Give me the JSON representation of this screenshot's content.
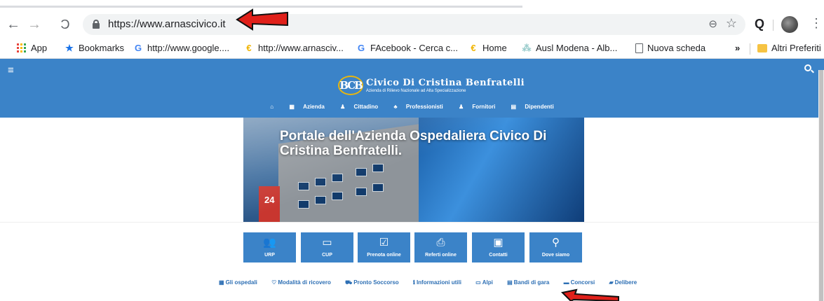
{
  "browser": {
    "url": "https://www.arnascivico.it",
    "nav_back_icon": "arrow-left-icon",
    "nav_forward_icon": "arrow-right-icon",
    "reload_icon": "reload-icon",
    "zoom_icon_glyph": "⊖",
    "star_icon_glyph": "☆",
    "ext_icon_glyph": "Q",
    "kebab_glyph": "⋮",
    "back_glyph": "←",
    "forward_glyph": "→",
    "reload_glyph": "C"
  },
  "bookmarks": {
    "items": [
      {
        "label": "App",
        "icon": "apps-grid-icon"
      },
      {
        "label": "Bookmarks",
        "icon": "star-icon",
        "glyph": "★"
      },
      {
        "label": "http://www.google....",
        "icon": "google-icon",
        "glyph": "G"
      },
      {
        "label": "http://www.arnasciv...",
        "icon": "site-favicon",
        "glyph": "€"
      },
      {
        "label": "FAcebook - Cerca c...",
        "icon": "google-icon",
        "glyph": "G"
      },
      {
        "label": "Home",
        "icon": "site-favicon",
        "glyph": "€"
      },
      {
        "label": "Ausl Modena - Alb...",
        "icon": "ausl-favicon",
        "glyph": "⁂"
      },
      {
        "label": "Nuova scheda",
        "icon": "document-icon"
      }
    ],
    "overflow_glyph": "»",
    "other": "Altri Preferiti"
  },
  "site": {
    "menu_glyph": "≡",
    "logo_mark": "BCB",
    "title": "Civico Di Cristina Benfratelli",
    "subtitle": "Azienda di Rilievo Nazionale ad Alta Specializzazione",
    "nav": [
      {
        "label": "",
        "glyph": "⌂"
      },
      {
        "label": "Azienda",
        "glyph": "▦"
      },
      {
        "label": "Cittadino",
        "glyph": "♟"
      },
      {
        "label": "Professionisti",
        "glyph": "♣"
      },
      {
        "label": "Fornitori",
        "glyph": "♟"
      },
      {
        "label": "Dipendenti",
        "glyph": "▤"
      }
    ],
    "hero_title": "Portale dell'Azienda Ospedaliera Civico Di Cristina Benfratelli.",
    "hero_sign": "24",
    "tiles": [
      {
        "label": "URP",
        "glyph": "👥"
      },
      {
        "label": "CUP",
        "glyph": "▭"
      },
      {
        "label": "Prenota online",
        "glyph": "☑"
      },
      {
        "label": "Referti online",
        "glyph": "⎙"
      },
      {
        "label": "Contatti",
        "glyph": "▣"
      },
      {
        "label": "Dove siamo",
        "glyph": "⚲"
      }
    ],
    "links": [
      {
        "label": "Gli ospedali",
        "glyph": "▦"
      },
      {
        "label": "Modalità di ricovero",
        "glyph": "♡"
      },
      {
        "label": "Pronto Soccorso",
        "glyph": "⛟"
      },
      {
        "label": "Informazioni utili",
        "glyph": "ℹ"
      },
      {
        "label": "Alpi",
        "glyph": "▭"
      },
      {
        "label": "Bandi di gara",
        "glyph": "▤"
      },
      {
        "label": "Concorsi",
        "glyph": "▬"
      },
      {
        "label": "Delibere",
        "glyph": "▰"
      }
    ]
  },
  "colors": {
    "brand_blue": "#3b83c8",
    "link_blue": "#2d6fb4",
    "annotation_red": "#e0201a"
  }
}
